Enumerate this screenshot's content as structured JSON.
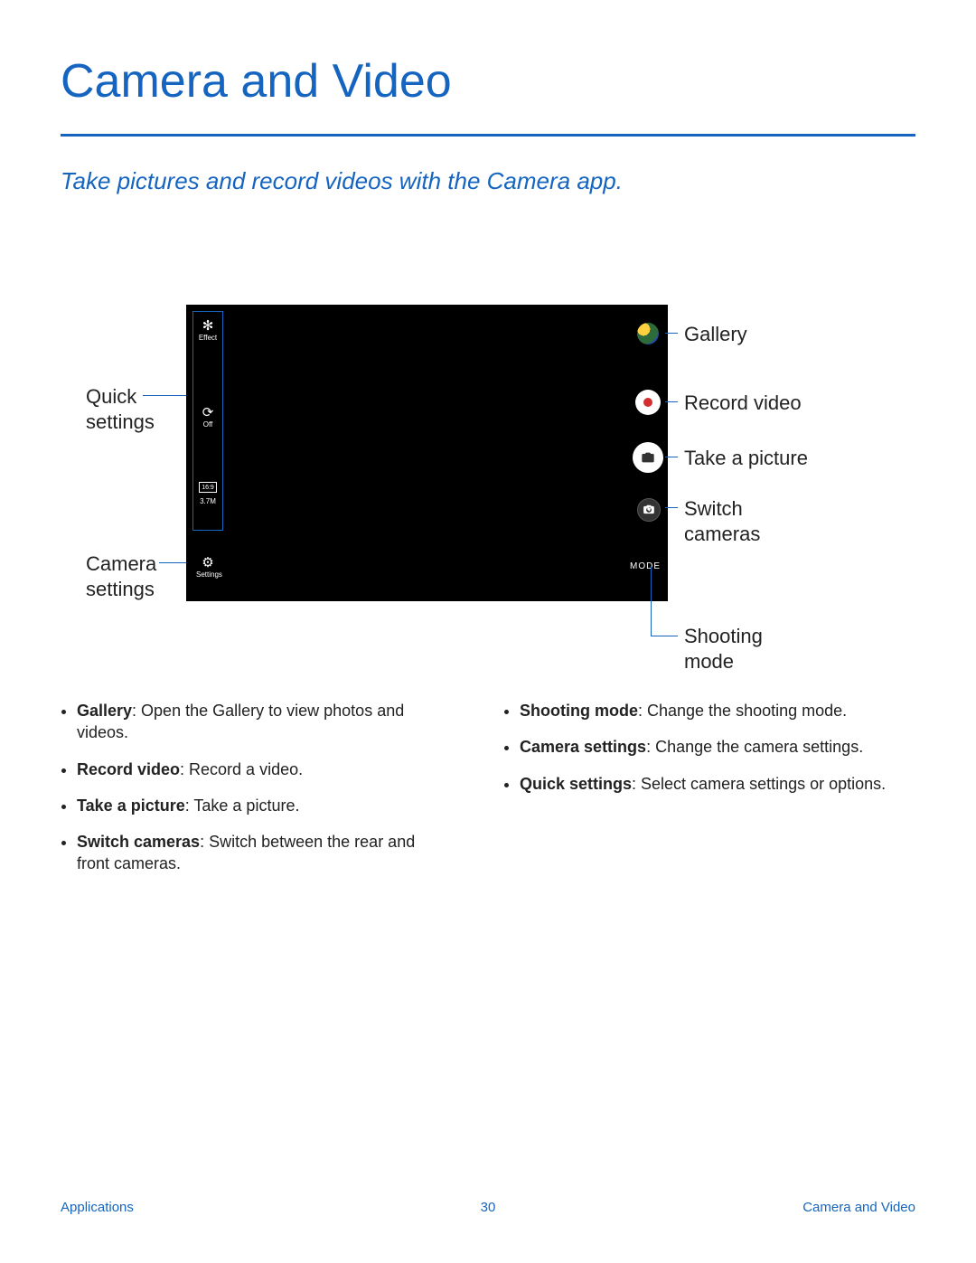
{
  "title": "Camera and Video",
  "subtitle": "Take pictures and record videos with the Camera app.",
  "shot": {
    "qs": {
      "effect": "Effect",
      "off": "Off",
      "ratio": "16:9",
      "size": "3.7M"
    },
    "settings_label": "Settings",
    "mode_label": "MODE"
  },
  "callouts": {
    "quick_settings": "Quick\nsettings",
    "camera_settings": "Camera\nsettings",
    "gallery": "Gallery",
    "record": "Record video",
    "take": "Take a picture",
    "switch": "Switch\ncameras",
    "shooting": "Shooting\nmode"
  },
  "bullets_left": [
    {
      "b": "Gallery",
      "t": ": Open the Gallery to view photos and videos."
    },
    {
      "b": "Record video",
      "t": ": Record a video."
    },
    {
      "b": "Take a picture",
      "t": ": Take a picture."
    },
    {
      "b": "Switch cameras",
      "t": ": Switch between the rear and front cameras."
    }
  ],
  "bullets_right": [
    {
      "b": "Shooting mode",
      "t": ": Change the shooting mode."
    },
    {
      "b": "Camera settings",
      "t": ": Change the camera settings."
    },
    {
      "b": "Quick settings",
      "t": ": Select camera settings or options."
    }
  ],
  "footer": {
    "left": "Applications",
    "page": "30",
    "right": "Camera and Video"
  }
}
